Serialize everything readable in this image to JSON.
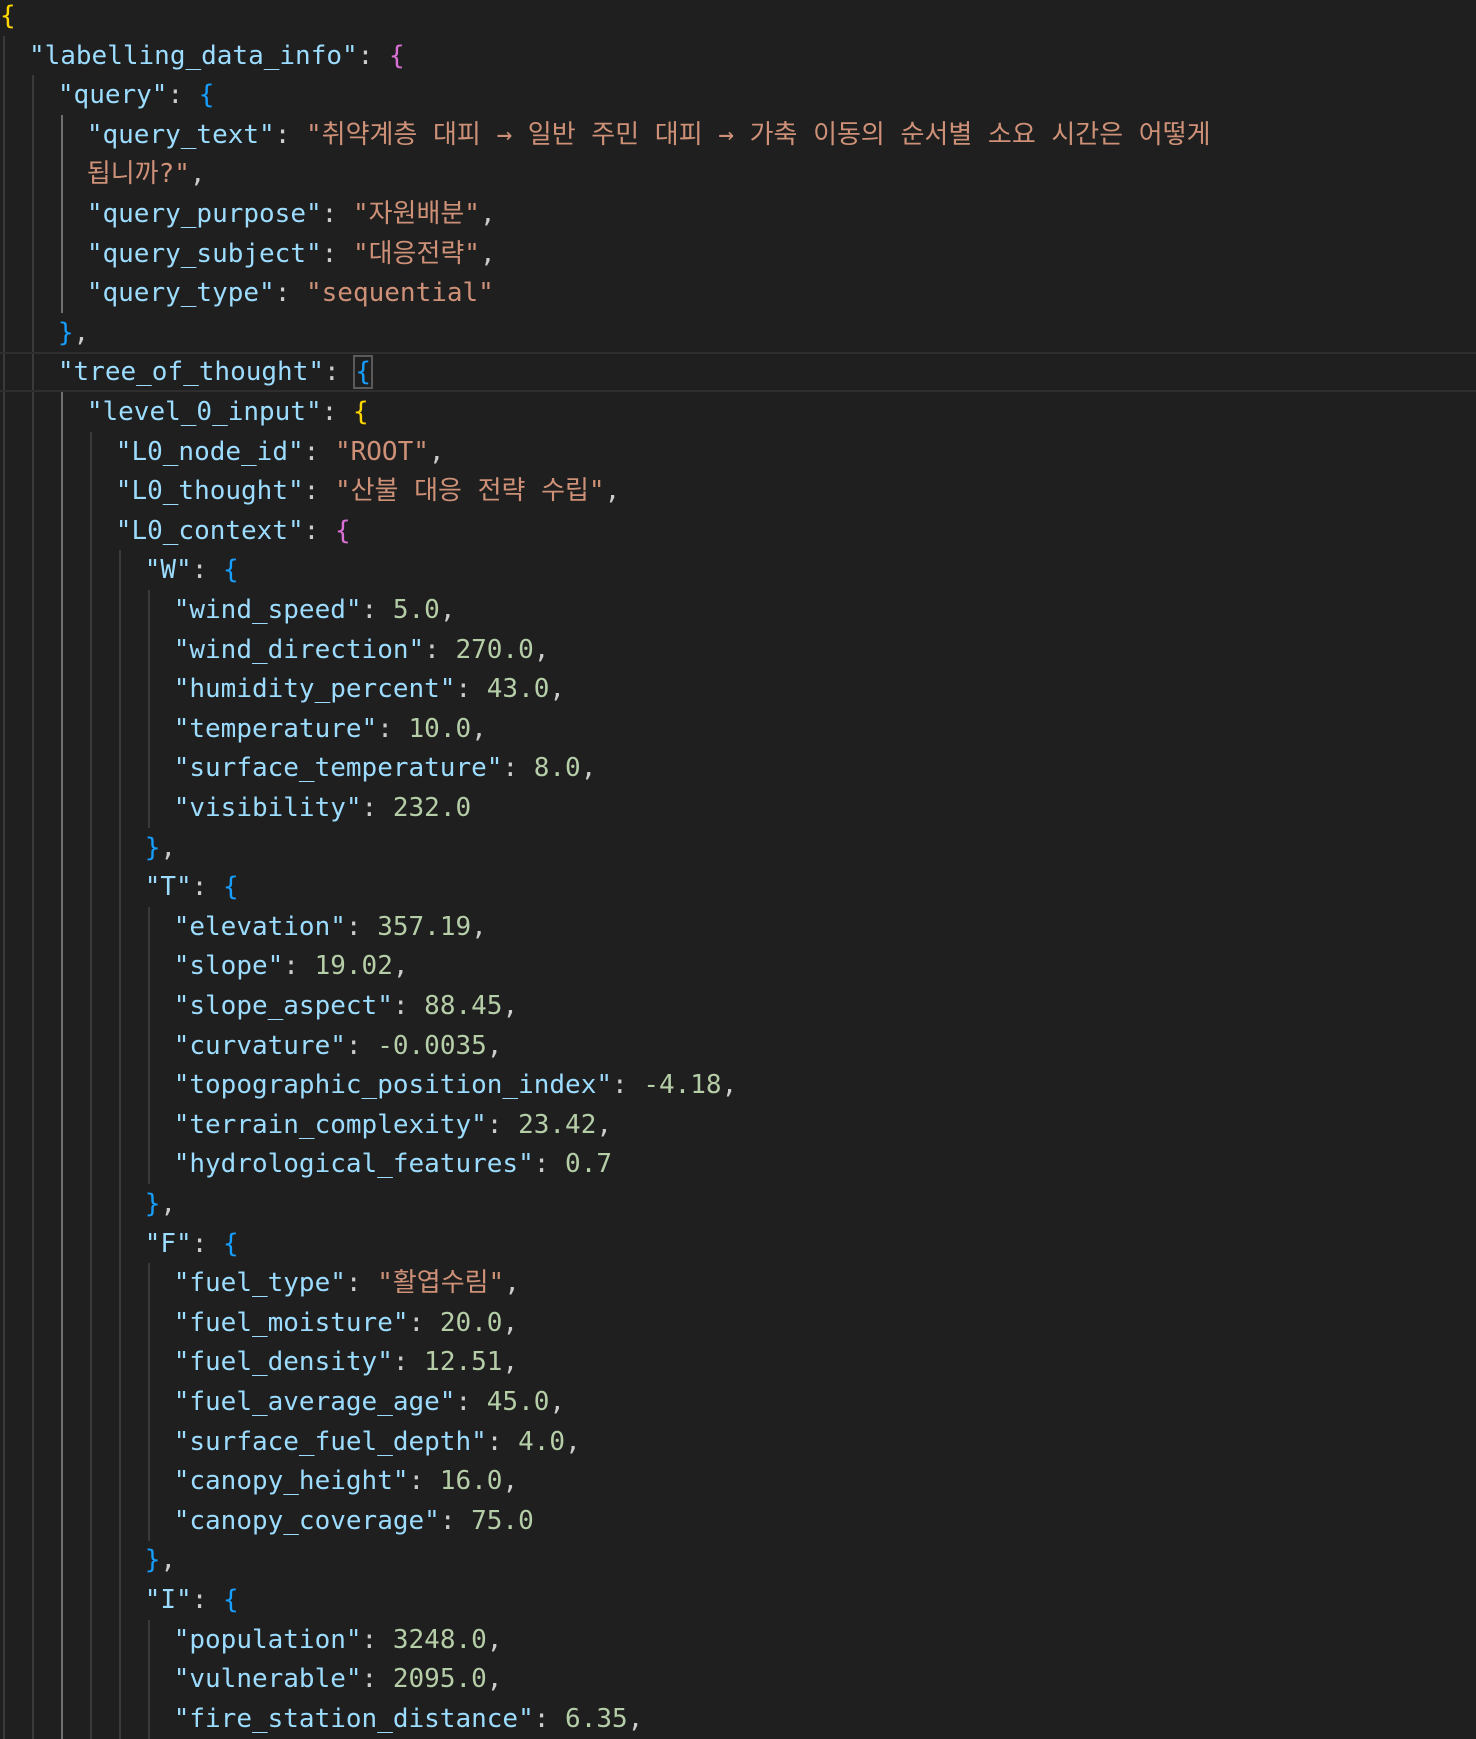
{
  "editor": {
    "language": "json",
    "theme": "dark",
    "visible_lines": [
      {
        "indent": 0,
        "tokens": [
          {
            "t": "b1",
            "v": "{"
          }
        ]
      },
      {
        "indent": 1,
        "tokens": [
          {
            "t": "k",
            "v": "\"labelling_data_info\""
          },
          {
            "t": "p",
            "v": ": "
          },
          {
            "t": "b2",
            "v": "{"
          }
        ]
      },
      {
        "indent": 2,
        "tokens": [
          {
            "t": "k",
            "v": "\"query\""
          },
          {
            "t": "p",
            "v": ": "
          },
          {
            "t": "b3",
            "v": "{"
          }
        ]
      },
      {
        "indent": 3,
        "tokens": [
          {
            "t": "k",
            "v": "\"query_text\""
          },
          {
            "t": "p",
            "v": ": "
          },
          {
            "t": "s",
            "v": "\"취약계층 대피 → 일반 주민 대피 → 가축 이동의 순서별 소요 시간은 어떻게"
          }
        ]
      },
      {
        "indent": 3,
        "tokens": [
          {
            "t": "s",
            "v": "됩니까?\""
          },
          {
            "t": "p",
            "v": ","
          }
        ]
      },
      {
        "indent": 3,
        "tokens": [
          {
            "t": "k",
            "v": "\"query_purpose\""
          },
          {
            "t": "p",
            "v": ": "
          },
          {
            "t": "s",
            "v": "\"자원배분\""
          },
          {
            "t": "p",
            "v": ","
          }
        ]
      },
      {
        "indent": 3,
        "tokens": [
          {
            "t": "k",
            "v": "\"query_subject\""
          },
          {
            "t": "p",
            "v": ": "
          },
          {
            "t": "s",
            "v": "\"대응전략\""
          },
          {
            "t": "p",
            "v": ","
          }
        ]
      },
      {
        "indent": 3,
        "tokens": [
          {
            "t": "k",
            "v": "\"query_type\""
          },
          {
            "t": "p",
            "v": ": "
          },
          {
            "t": "s",
            "v": "\"sequential\""
          }
        ]
      },
      {
        "indent": 2,
        "tokens": [
          {
            "t": "b3",
            "v": "}"
          },
          {
            "t": "p",
            "v": ","
          }
        ]
      },
      {
        "indent": 2,
        "current": true,
        "tokens": [
          {
            "t": "k",
            "v": "\"tree_of_thought\""
          },
          {
            "t": "p",
            "v": ": "
          },
          {
            "t": "b3",
            "v": "{",
            "cursor": true
          }
        ]
      },
      {
        "indent": 3,
        "tokens": [
          {
            "t": "k",
            "v": "\"level_0_input\""
          },
          {
            "t": "p",
            "v": ": "
          },
          {
            "t": "b1",
            "v": "{"
          }
        ]
      },
      {
        "indent": 4,
        "tokens": [
          {
            "t": "k",
            "v": "\"L0_node_id\""
          },
          {
            "t": "p",
            "v": ": "
          },
          {
            "t": "s",
            "v": "\"ROOT\""
          },
          {
            "t": "p",
            "v": ","
          }
        ]
      },
      {
        "indent": 4,
        "tokens": [
          {
            "t": "k",
            "v": "\"L0_thought\""
          },
          {
            "t": "p",
            "v": ": "
          },
          {
            "t": "s",
            "v": "\"산불 대응 전략 수립\""
          },
          {
            "t": "p",
            "v": ","
          }
        ]
      },
      {
        "indent": 4,
        "tokens": [
          {
            "t": "k",
            "v": "\"L0_context\""
          },
          {
            "t": "p",
            "v": ": "
          },
          {
            "t": "b2",
            "v": "{"
          }
        ]
      },
      {
        "indent": 5,
        "tokens": [
          {
            "t": "k",
            "v": "\"W\""
          },
          {
            "t": "p",
            "v": ": "
          },
          {
            "t": "b3",
            "v": "{"
          }
        ]
      },
      {
        "indent": 6,
        "tokens": [
          {
            "t": "k",
            "v": "\"wind_speed\""
          },
          {
            "t": "p",
            "v": ": "
          },
          {
            "t": "n",
            "v": "5.0"
          },
          {
            "t": "p",
            "v": ","
          }
        ]
      },
      {
        "indent": 6,
        "tokens": [
          {
            "t": "k",
            "v": "\"wind_direction\""
          },
          {
            "t": "p",
            "v": ": "
          },
          {
            "t": "n",
            "v": "270.0"
          },
          {
            "t": "p",
            "v": ","
          }
        ]
      },
      {
        "indent": 6,
        "tokens": [
          {
            "t": "k",
            "v": "\"humidity_percent\""
          },
          {
            "t": "p",
            "v": ": "
          },
          {
            "t": "n",
            "v": "43.0"
          },
          {
            "t": "p",
            "v": ","
          }
        ]
      },
      {
        "indent": 6,
        "tokens": [
          {
            "t": "k",
            "v": "\"temperature\""
          },
          {
            "t": "p",
            "v": ": "
          },
          {
            "t": "n",
            "v": "10.0"
          },
          {
            "t": "p",
            "v": ","
          }
        ]
      },
      {
        "indent": 6,
        "tokens": [
          {
            "t": "k",
            "v": "\"surface_temperature\""
          },
          {
            "t": "p",
            "v": ": "
          },
          {
            "t": "n",
            "v": "8.0"
          },
          {
            "t": "p",
            "v": ","
          }
        ]
      },
      {
        "indent": 6,
        "tokens": [
          {
            "t": "k",
            "v": "\"visibility\""
          },
          {
            "t": "p",
            "v": ": "
          },
          {
            "t": "n",
            "v": "232.0"
          }
        ]
      },
      {
        "indent": 5,
        "tokens": [
          {
            "t": "b3",
            "v": "}"
          },
          {
            "t": "p",
            "v": ","
          }
        ]
      },
      {
        "indent": 5,
        "tokens": [
          {
            "t": "k",
            "v": "\"T\""
          },
          {
            "t": "p",
            "v": ": "
          },
          {
            "t": "b3",
            "v": "{"
          }
        ]
      },
      {
        "indent": 6,
        "tokens": [
          {
            "t": "k",
            "v": "\"elevation\""
          },
          {
            "t": "p",
            "v": ": "
          },
          {
            "t": "n",
            "v": "357.19"
          },
          {
            "t": "p",
            "v": ","
          }
        ]
      },
      {
        "indent": 6,
        "tokens": [
          {
            "t": "k",
            "v": "\"slope\""
          },
          {
            "t": "p",
            "v": ": "
          },
          {
            "t": "n",
            "v": "19.02"
          },
          {
            "t": "p",
            "v": ","
          }
        ]
      },
      {
        "indent": 6,
        "tokens": [
          {
            "t": "k",
            "v": "\"slope_aspect\""
          },
          {
            "t": "p",
            "v": ": "
          },
          {
            "t": "n",
            "v": "88.45"
          },
          {
            "t": "p",
            "v": ","
          }
        ]
      },
      {
        "indent": 6,
        "tokens": [
          {
            "t": "k",
            "v": "\"curvature\""
          },
          {
            "t": "p",
            "v": ": "
          },
          {
            "t": "n",
            "v": "-0.0035"
          },
          {
            "t": "p",
            "v": ","
          }
        ]
      },
      {
        "indent": 6,
        "tokens": [
          {
            "t": "k",
            "v": "\"topographic_position_index\""
          },
          {
            "t": "p",
            "v": ": "
          },
          {
            "t": "n",
            "v": "-4.18"
          },
          {
            "t": "p",
            "v": ","
          }
        ]
      },
      {
        "indent": 6,
        "tokens": [
          {
            "t": "k",
            "v": "\"terrain_complexity\""
          },
          {
            "t": "p",
            "v": ": "
          },
          {
            "t": "n",
            "v": "23.42"
          },
          {
            "t": "p",
            "v": ","
          }
        ]
      },
      {
        "indent": 6,
        "tokens": [
          {
            "t": "k",
            "v": "\"hydrological_features\""
          },
          {
            "t": "p",
            "v": ": "
          },
          {
            "t": "n",
            "v": "0.7"
          }
        ]
      },
      {
        "indent": 5,
        "tokens": [
          {
            "t": "b3",
            "v": "}"
          },
          {
            "t": "p",
            "v": ","
          }
        ]
      },
      {
        "indent": 5,
        "tokens": [
          {
            "t": "k",
            "v": "\"F\""
          },
          {
            "t": "p",
            "v": ": "
          },
          {
            "t": "b3",
            "v": "{"
          }
        ]
      },
      {
        "indent": 6,
        "tokens": [
          {
            "t": "k",
            "v": "\"fuel_type\""
          },
          {
            "t": "p",
            "v": ": "
          },
          {
            "t": "s",
            "v": "\"활엽수림\""
          },
          {
            "t": "p",
            "v": ","
          }
        ]
      },
      {
        "indent": 6,
        "tokens": [
          {
            "t": "k",
            "v": "\"fuel_moisture\""
          },
          {
            "t": "p",
            "v": ": "
          },
          {
            "t": "n",
            "v": "20.0"
          },
          {
            "t": "p",
            "v": ","
          }
        ]
      },
      {
        "indent": 6,
        "tokens": [
          {
            "t": "k",
            "v": "\"fuel_density\""
          },
          {
            "t": "p",
            "v": ": "
          },
          {
            "t": "n",
            "v": "12.51"
          },
          {
            "t": "p",
            "v": ","
          }
        ]
      },
      {
        "indent": 6,
        "tokens": [
          {
            "t": "k",
            "v": "\"fuel_average_age\""
          },
          {
            "t": "p",
            "v": ": "
          },
          {
            "t": "n",
            "v": "45.0"
          },
          {
            "t": "p",
            "v": ","
          }
        ]
      },
      {
        "indent": 6,
        "tokens": [
          {
            "t": "k",
            "v": "\"surface_fuel_depth\""
          },
          {
            "t": "p",
            "v": ": "
          },
          {
            "t": "n",
            "v": "4.0"
          },
          {
            "t": "p",
            "v": ","
          }
        ]
      },
      {
        "indent": 6,
        "tokens": [
          {
            "t": "k",
            "v": "\"canopy_height\""
          },
          {
            "t": "p",
            "v": ": "
          },
          {
            "t": "n",
            "v": "16.0"
          },
          {
            "t": "p",
            "v": ","
          }
        ]
      },
      {
        "indent": 6,
        "tokens": [
          {
            "t": "k",
            "v": "\"canopy_coverage\""
          },
          {
            "t": "p",
            "v": ": "
          },
          {
            "t": "n",
            "v": "75.0"
          }
        ]
      },
      {
        "indent": 5,
        "tokens": [
          {
            "t": "b3",
            "v": "}"
          },
          {
            "t": "p",
            "v": ","
          }
        ]
      },
      {
        "indent": 5,
        "tokens": [
          {
            "t": "k",
            "v": "\"I\""
          },
          {
            "t": "p",
            "v": ": "
          },
          {
            "t": "b3",
            "v": "{"
          }
        ]
      },
      {
        "indent": 6,
        "tokens": [
          {
            "t": "k",
            "v": "\"population\""
          },
          {
            "t": "p",
            "v": ": "
          },
          {
            "t": "n",
            "v": "3248.0"
          },
          {
            "t": "p",
            "v": ","
          }
        ]
      },
      {
        "indent": 6,
        "tokens": [
          {
            "t": "k",
            "v": "\"vulnerable\""
          },
          {
            "t": "p",
            "v": ": "
          },
          {
            "t": "n",
            "v": "2095.0"
          },
          {
            "t": "p",
            "v": ","
          }
        ]
      },
      {
        "indent": 6,
        "tokens": [
          {
            "t": "k",
            "v": "\"fire_station_distance\""
          },
          {
            "t": "p",
            "v": ": "
          },
          {
            "t": "n",
            "v": "6.35"
          },
          {
            "t": "p",
            "v": ","
          }
        ]
      }
    ]
  }
}
